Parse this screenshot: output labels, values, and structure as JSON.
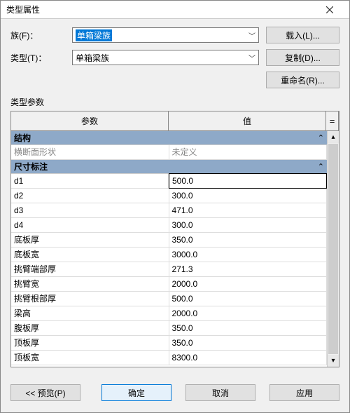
{
  "window": {
    "title": "类型属性"
  },
  "form": {
    "family_label": "族(F)：",
    "family_value": "单箱梁族",
    "type_label": "类型(T)：",
    "type_value": "单箱梁族",
    "load_btn": "载入(L)...",
    "duplicate_btn": "复制(D)...",
    "rename_btn": "重命名(R)..."
  },
  "params_label": "类型参数",
  "table": {
    "col_param": "参数",
    "col_value": "值",
    "col_eq": "=",
    "groups": [
      {
        "name": "结构",
        "rows": [
          {
            "param": "横断面形状",
            "value": "未定义",
            "disabled": true
          }
        ]
      },
      {
        "name": "尺寸标注",
        "rows": [
          {
            "param": "d1",
            "value": "500.0",
            "active": true
          },
          {
            "param": "d2",
            "value": "300.0"
          },
          {
            "param": "d3",
            "value": "471.0"
          },
          {
            "param": "d4",
            "value": "300.0"
          },
          {
            "param": "底板厚",
            "value": "350.0"
          },
          {
            "param": "底板宽",
            "value": "3000.0"
          },
          {
            "param": "挑臂端部厚",
            "value": "271.3"
          },
          {
            "param": "挑臂宽",
            "value": "2000.0"
          },
          {
            "param": "挑臂根部厚",
            "value": "500.0"
          },
          {
            "param": "梁高",
            "value": "2000.0"
          },
          {
            "param": "腹板厚",
            "value": "350.0"
          },
          {
            "param": "顶板厚",
            "value": "350.0"
          },
          {
            "param": "顶板宽",
            "value": "8300.0"
          }
        ]
      }
    ]
  },
  "footer": {
    "preview": "<< 预览(P)",
    "ok": "确定",
    "cancel": "取消",
    "apply": "应用"
  }
}
